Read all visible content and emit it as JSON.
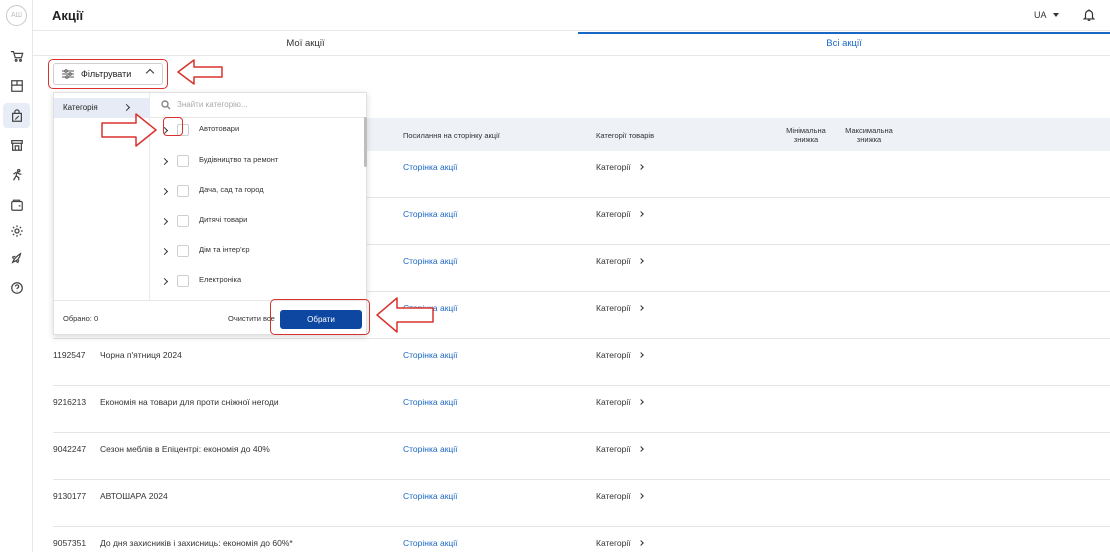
{
  "app": {
    "logo_text": "AШ",
    "title": "Акції",
    "language": "UA"
  },
  "tabs": [
    {
      "label": "Мої акції",
      "active": false
    },
    {
      "label": "Всі акції",
      "active": true
    }
  ],
  "filter": {
    "button_label": "Фільтрувати"
  },
  "panel": {
    "category_label": "Категорія",
    "search_placeholder": "Знайти категорію...",
    "items": [
      {
        "label": "Автотовари"
      },
      {
        "label": "Будівництво та ремонт"
      },
      {
        "label": "Дача, сад та город"
      },
      {
        "label": "Дитячі товари"
      },
      {
        "label": "Дім та інтер'єр"
      },
      {
        "label": "Електроніка"
      }
    ],
    "selected_count_label": "Обрано: 0",
    "clear_label": "Очистити все",
    "apply_label": "Обрати"
  },
  "table": {
    "headers": {
      "link": "Посилання на сторінку акції",
      "categories": "Категорії товарів",
      "min_discount": "Мінімальна знижка",
      "max_discount": "Максимальна знижка"
    },
    "link_text": "Сторінка акції",
    "categories_text": "Категорії",
    "rows": [
      {
        "id": "",
        "name": ""
      },
      {
        "id": "",
        "name": ""
      },
      {
        "id": "",
        "name": ""
      },
      {
        "id": "",
        "name": ""
      },
      {
        "id": "1192547",
        "name": "Чорна п'ятниця 2024"
      },
      {
        "id": "9216213",
        "name": "Економія на товари для проти сніжної негоди"
      },
      {
        "id": "9042247",
        "name": "Сезон меблів в Епіцентрі: економія до 40%"
      },
      {
        "id": "9130177",
        "name": "АВТОШАРА 2024"
      },
      {
        "id": "9057351",
        "name": "До дня захисників і захисниць: економія до 60%*"
      }
    ]
  },
  "colors": {
    "accent": "#1a67c4",
    "primary_button": "#0d47a1",
    "annotation": "#d9322e",
    "header_bg": "#eef1f6"
  },
  "icons": {
    "rail": [
      "cart-icon",
      "catalog-icon",
      "promotions-icon",
      "store-icon",
      "running-icon",
      "wallet-icon",
      "settings-icon",
      "rocket-icon",
      "help-icon"
    ],
    "header": [
      "chevron-down-icon",
      "bell-icon"
    ]
  }
}
